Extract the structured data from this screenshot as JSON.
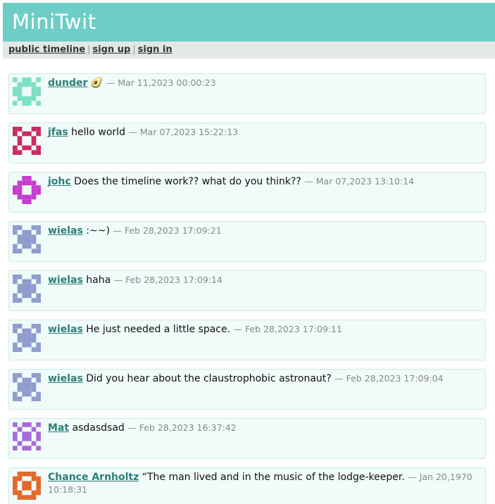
{
  "header": {
    "title": "MiniTwit"
  },
  "nav": {
    "public_timeline": "public timeline",
    "sign_up": "sign up",
    "sign_in": "sign in",
    "separator": "|"
  },
  "messages": [
    {
      "user": "dunder",
      "text": "🥑",
      "date": "— Mar 11,2023 00:00:23",
      "avatar_color": "#7ee0c2",
      "avatar_icon": "identicon-avatar-icon"
    },
    {
      "user": "jfas",
      "text": "hello world",
      "date": "— Mar 07,2023 15:22:13",
      "avatar_color": "#cc2a63",
      "avatar_icon": "identicon-avatar-icon"
    },
    {
      "user": "johc",
      "text": "Does the timeline work?? what do you think??",
      "date": "— Mar 07,2023 13:10:14",
      "avatar_color": "#c53ccf",
      "avatar_icon": "identicon-avatar-icon"
    },
    {
      "user": "wielas",
      "text": ":~~)",
      "date": "— Feb 28,2023 17:09:21",
      "avatar_color": "#8f9ccd",
      "avatar_icon": "identicon-avatar-icon"
    },
    {
      "user": "wielas",
      "text": "haha",
      "date": "— Feb 28,2023 17:09:14",
      "avatar_color": "#8f9ccd",
      "avatar_icon": "identicon-avatar-icon"
    },
    {
      "user": "wielas",
      "text": "He just needed a little space.",
      "date": "— Feb 28,2023 17:09:11",
      "avatar_color": "#8f9ccd",
      "avatar_icon": "identicon-avatar-icon"
    },
    {
      "user": "wielas",
      "text": "Did you hear about the claustrophobic astronaut?",
      "date": "— Feb 28,2023 17:09:04",
      "avatar_color": "#8f9ccd",
      "avatar_icon": "identicon-avatar-icon"
    },
    {
      "user": "Mat",
      "text": "asdasdsad",
      "date": "— Feb 28,2023 16:37:42",
      "avatar_color": "#a86bd9",
      "avatar_icon": "identicon-avatar-icon"
    },
    {
      "user": "Chance Arnholtz",
      "text": "“The man lived and in the music of the lodge-keeper.",
      "date": "— Jan 20,1970 10:18:31",
      "avatar_color": "#e3692a",
      "avatar_icon": "identicon-avatar-icon"
    }
  ]
}
